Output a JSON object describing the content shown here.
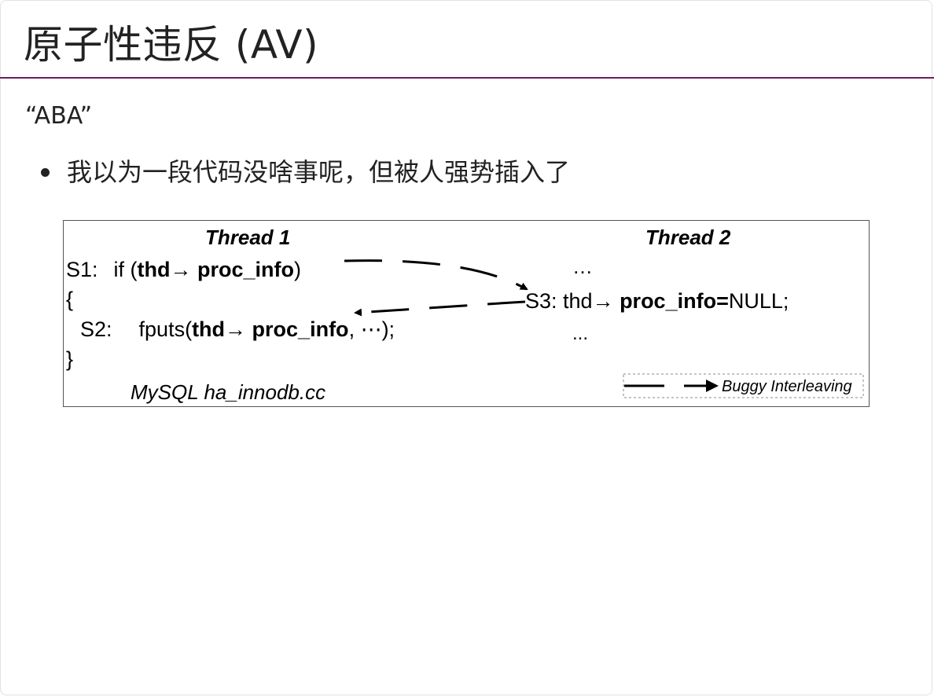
{
  "slide": {
    "title": "原子性违反 (AV)",
    "subtitle": "“ABA”",
    "bullets": [
      "我以为一段代码没啥事呢，但被人强势插入了"
    ]
  },
  "figure": {
    "thread1_header": "Thread 1",
    "thread2_header": "Thread 2",
    "s1_label": "S1:",
    "s1_if": "if (",
    "s1_thd": "thd",
    "s1_arrow": "→",
    "s1_proc": " proc_info",
    "s1_close": ")",
    "open_brace": "{",
    "s2_label": "S2:",
    "s2_fputs": "fputs(",
    "s2_thd": "thd",
    "s2_arrow": "→",
    "s2_proc": " proc_info",
    "s2_rest": ", ⋯);",
    "close_brace": "}",
    "t2_dots_top": "…",
    "s3_label": "S3: thd",
    "s3_arrow": "→",
    "s3_proc": " proc_info=",
    "s3_null": "NULL;",
    "t2_dots_bottom": "...",
    "caption": "MySQL ha_innodb.cc",
    "legend_label": "Buggy Interleaving"
  }
}
